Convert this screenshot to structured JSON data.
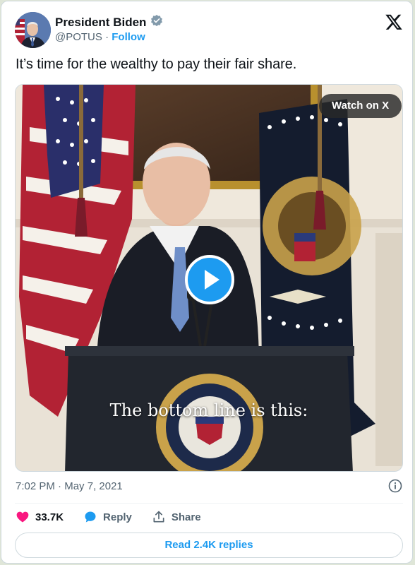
{
  "author": {
    "name": "President Biden",
    "handle": "@POTUS",
    "separator": "·",
    "follow_label": "Follow",
    "verified_color": "#829aab"
  },
  "tweet": {
    "text": "It’s time for the wealthy to pay their fair share."
  },
  "media": {
    "watch_label": "Watch on X",
    "caption": "The bottom line is this:"
  },
  "meta": {
    "time": "7:02 PM",
    "separator": "·",
    "date": "May 7, 2021"
  },
  "actions": {
    "likes": "33.7K",
    "reply_label": "Reply",
    "share_label": "Share"
  },
  "read_replies_label": "Read 2.4K replies",
  "colors": {
    "accent": "#1d9bf0",
    "like": "#f91880",
    "muted": "#536471"
  }
}
